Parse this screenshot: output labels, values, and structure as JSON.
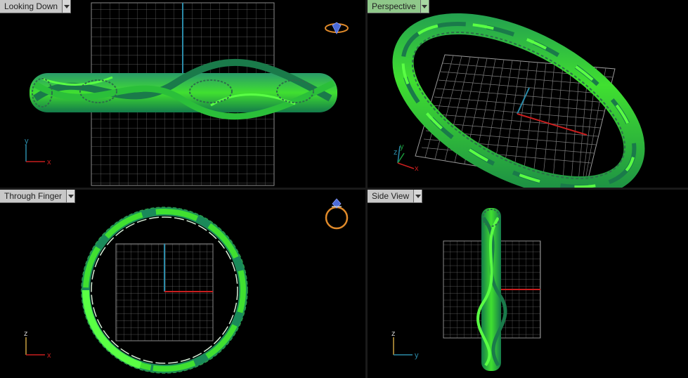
{
  "viewports": {
    "top": {
      "label": "Looking Down",
      "axis_v": "y",
      "axis_h": "x"
    },
    "perspective": {
      "label": "Perspective",
      "axis_v": "z",
      "axis_v2": "y",
      "axis_h": "x"
    },
    "front": {
      "label": "Through Finger",
      "axis_v": "z",
      "axis_h": "x"
    },
    "side": {
      "label": "Side View",
      "axis_v": "z",
      "axis_h": "y"
    }
  },
  "colors": {
    "background": "#000000",
    "grid": "#7a7a7a",
    "axis_x": "#c81e1e",
    "axis_y_blue": "#2a8aa8",
    "band_bright": "#39e12a",
    "band_dark": "#1a8a5a",
    "active_tab": "#8fc88a",
    "ring_icon": "#e08a2a"
  },
  "icons": {
    "top": "ring-top-icon",
    "front": "ring-front-icon"
  }
}
